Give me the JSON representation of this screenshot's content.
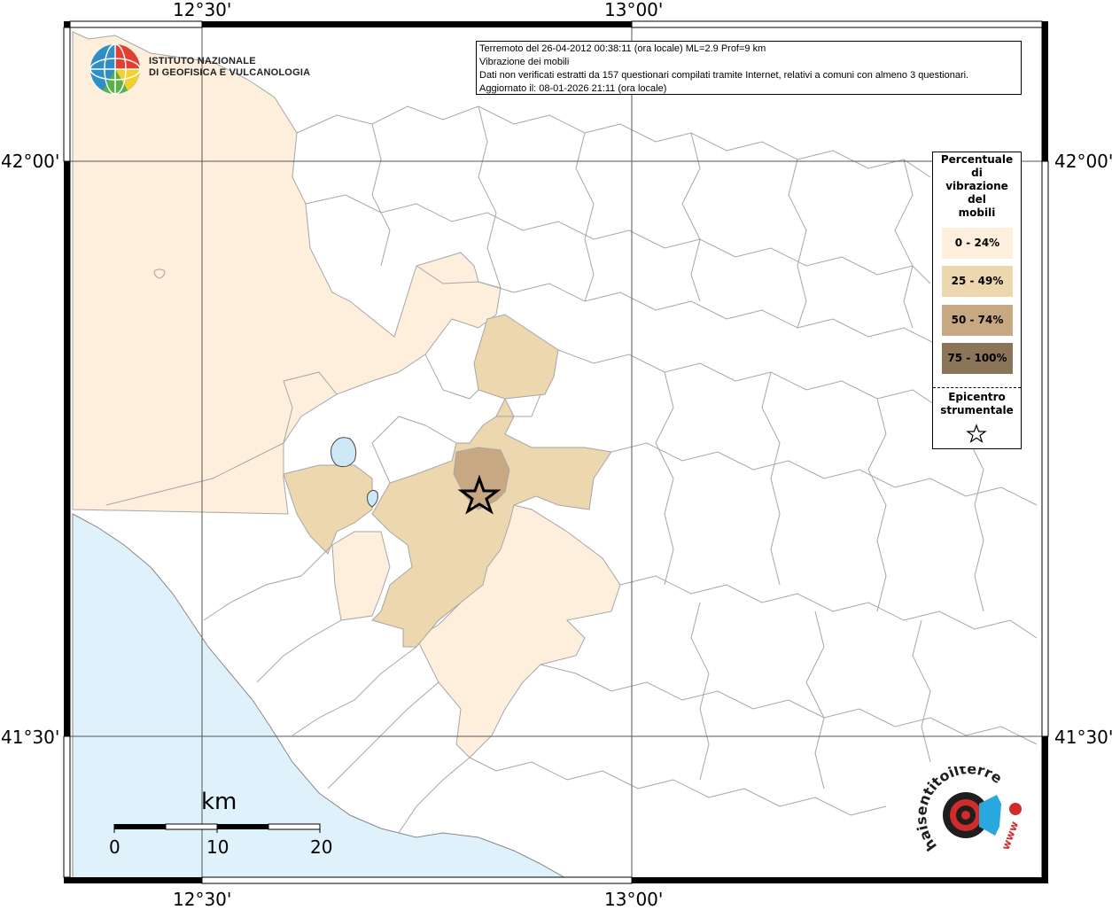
{
  "axes": {
    "top_left": "12°30'",
    "top_right": "13°00'",
    "bottom_left": "12°30'",
    "bottom_right": "13°00'",
    "left_top": "42°00'",
    "left_bottom": "41°30'",
    "right_top": "42°00'",
    "right_bottom": "41°30'"
  },
  "info": {
    "line1": "Terremoto del 26-04-2012 00:38:11 (ora locale) ML=2.9 Prof=9 km",
    "line2": "Vibrazione dei mobili",
    "line3": "Dati non verificati estratti da 157 questionari compilati tramite Internet, relativi a comuni con almeno 3 questionari.",
    "line4": "Aggiornato il: 08-01-2026 21:11 (ora locale)"
  },
  "institute": {
    "line1": "ISTITUTO NAZIONALE",
    "line2": "DI GEOFISICA E VULCANOLOGIA"
  },
  "legend": {
    "title_lines": [
      "Percentuale",
      "di",
      "vibrazione",
      "del",
      "mobili"
    ],
    "items": [
      {
        "label": "0 - 24%",
        "color": "#fdefdc"
      },
      {
        "label": "25 - 49%",
        "color": "#ecd7ae"
      },
      {
        "label": "50 - 74%",
        "color": "#c8a882"
      },
      {
        "label": "75 - 100%",
        "color": "#8c7459"
      }
    ],
    "epicenter_lines": [
      "Epicentro",
      "strumentale"
    ]
  },
  "scale": {
    "unit": "km",
    "labels": [
      "0",
      "10",
      "20"
    ]
  },
  "website_logo": {
    "text": "haisentitoilterremoto.it",
    "url_text": "www"
  },
  "colors": {
    "sea": "#dff1fb",
    "lake": "#cfe8f7",
    "boundary": "#a6a6a6",
    "frame": "#000000"
  }
}
